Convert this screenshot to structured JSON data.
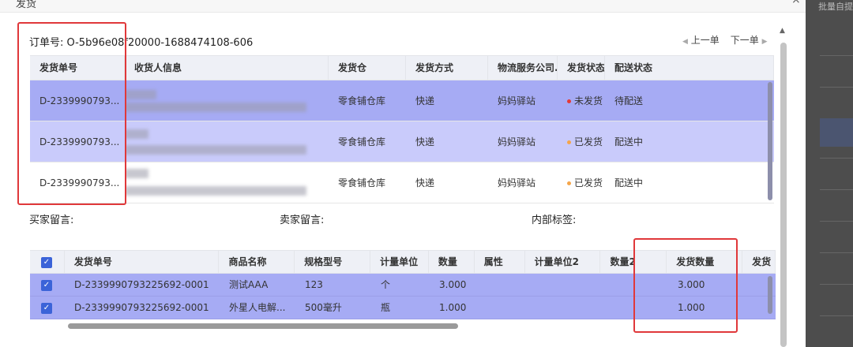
{
  "modal": {
    "title": "发货",
    "close_glyph": "×",
    "order_label": "订单号: O-5b96e08f20000-1688474108-606",
    "prev_label": "上一单",
    "next_label": "下一单"
  },
  "backdrop": {
    "text": "批量自提"
  },
  "shipments": {
    "headers": [
      "发货单号",
      "收货人信息",
      "发货仓",
      "发货方式",
      "物流服务公司.",
      "发货状态",
      "配送状态"
    ],
    "rows": [
      {
        "id": "D-2339990793...",
        "warehouse": "零食铺仓库",
        "method": "快递",
        "logistics": "妈妈驿站",
        "ship_status": "未发货",
        "ship_status_color": "#e53935",
        "delivery_status": "待配送"
      },
      {
        "id": "D-2339990793...",
        "warehouse": "零食铺仓库",
        "method": "快递",
        "logistics": "妈妈驿站",
        "ship_status": "已发货",
        "ship_status_color": "#f5a54a",
        "delivery_status": "配送中"
      },
      {
        "id": "D-2339990793...",
        "warehouse": "零食铺仓库",
        "method": "快递",
        "logistics": "妈妈驿站",
        "ship_status": "已发货",
        "ship_status_color": "#f5a54a",
        "delivery_status": "配送中"
      }
    ]
  },
  "messages": {
    "buyer": "买家留言:",
    "seller": "卖家留言:",
    "internal": "内部标签:"
  },
  "goods": {
    "headers": [
      "发货单号",
      "商品名称",
      "规格型号",
      "计量单位",
      "数量",
      "属性",
      "计量单位2",
      "数量2",
      "发货数量",
      "发货"
    ],
    "rows": [
      {
        "id": "D-2339990793225692-0001",
        "name": "测试AAA",
        "spec": "123",
        "unit": "个",
        "qty": "3.000",
        "attr": "",
        "unit2": "",
        "qty2": "",
        "ship_qty": "3.000"
      },
      {
        "id": "D-2339990793225692-0001",
        "name": "外星人电解...",
        "spec": "500毫升",
        "unit": "瓶",
        "qty": "1.000",
        "attr": "",
        "unit2": "",
        "qty2": "",
        "ship_qty": "1.000"
      }
    ]
  },
  "colors": {
    "selected_row": "#a6abf4",
    "selected_row_light": "#c9cbfb",
    "annotation": "#e0383a",
    "checkbox": "#3b63d8"
  }
}
